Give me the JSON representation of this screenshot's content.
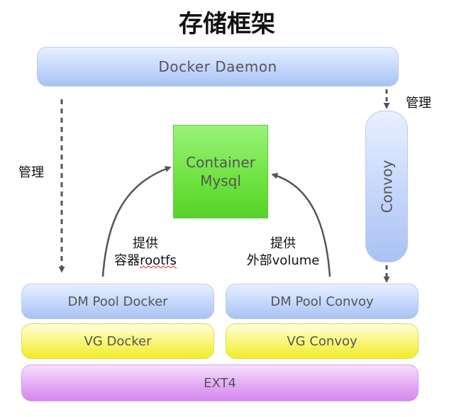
{
  "title": "存储框架",
  "nodes": {
    "docker_daemon": "Docker Daemon",
    "convoy": "Convoy",
    "container_line1": "Container",
    "container_line2": "Mysql",
    "dm_pool_docker": "DM Pool Docker",
    "dm_pool_convoy": "DM Pool Convoy",
    "vg_docker": "VG Docker",
    "vg_convoy": "VG Convoy",
    "ext4": "EXT4"
  },
  "labels": {
    "manage_left": "管理",
    "manage_right": "管理",
    "provide_left_line1": "提供",
    "provide_left_prefix": "容器",
    "provide_left_word": "rootfs",
    "provide_right_line1": "提供",
    "provide_right_line2": "外部volume"
  },
  "colors": {
    "blue": "#c4d6fb",
    "yellow": "#f9f674",
    "purple": "#e3a6f5",
    "green": "#6de33f",
    "arrow": "#555555"
  }
}
